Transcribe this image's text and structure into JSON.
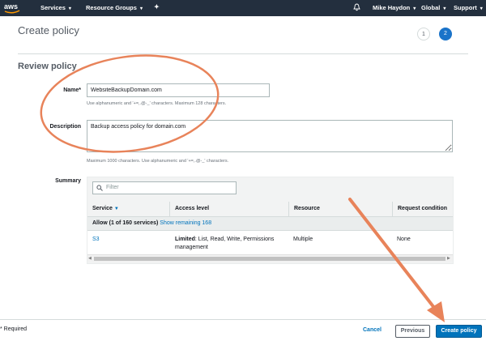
{
  "nav": {
    "logo_text": "aws",
    "services": "Services",
    "resource_groups": "Resource Groups",
    "user": "Mike Haydon",
    "region": "Global",
    "support": "Support"
  },
  "page": {
    "title": "Create policy",
    "steps": [
      "1",
      "2"
    ],
    "current_step": "2",
    "section_title": "Review policy"
  },
  "form": {
    "name_label": "Name*",
    "name_value": "WebsiteBackupDomain.com",
    "name_hint": "Use alphanumeric and '+=,.@-_' characters. Maximum 128 characters.",
    "description_label": "Description",
    "description_value": "Backup access policy for domain.com",
    "description_hint": "Maximum 1000 characters. Use alphanumeric and '+=,.@-_' characters.",
    "summary_label": "Summary"
  },
  "summary": {
    "filter_placeholder": "Filter",
    "columns": [
      "Service",
      "Access level",
      "Resource",
      "Request condition"
    ],
    "allow_text": "Allow (1 of 160 services)",
    "show_remaining": "Show remaining 168",
    "rows": [
      {
        "service": "S3",
        "access_bold": "Limited",
        "access_rest": ": List, Read, Write, Permissions management",
        "resource": "Multiple",
        "condition": "None"
      }
    ]
  },
  "footer": {
    "required": "* Required",
    "cancel": "Cancel",
    "previous": "Previous",
    "create": "Create policy"
  },
  "colors": {
    "nav_bg": "#232f3e",
    "annotation": "#e8835a",
    "primary": "#0073bb"
  }
}
